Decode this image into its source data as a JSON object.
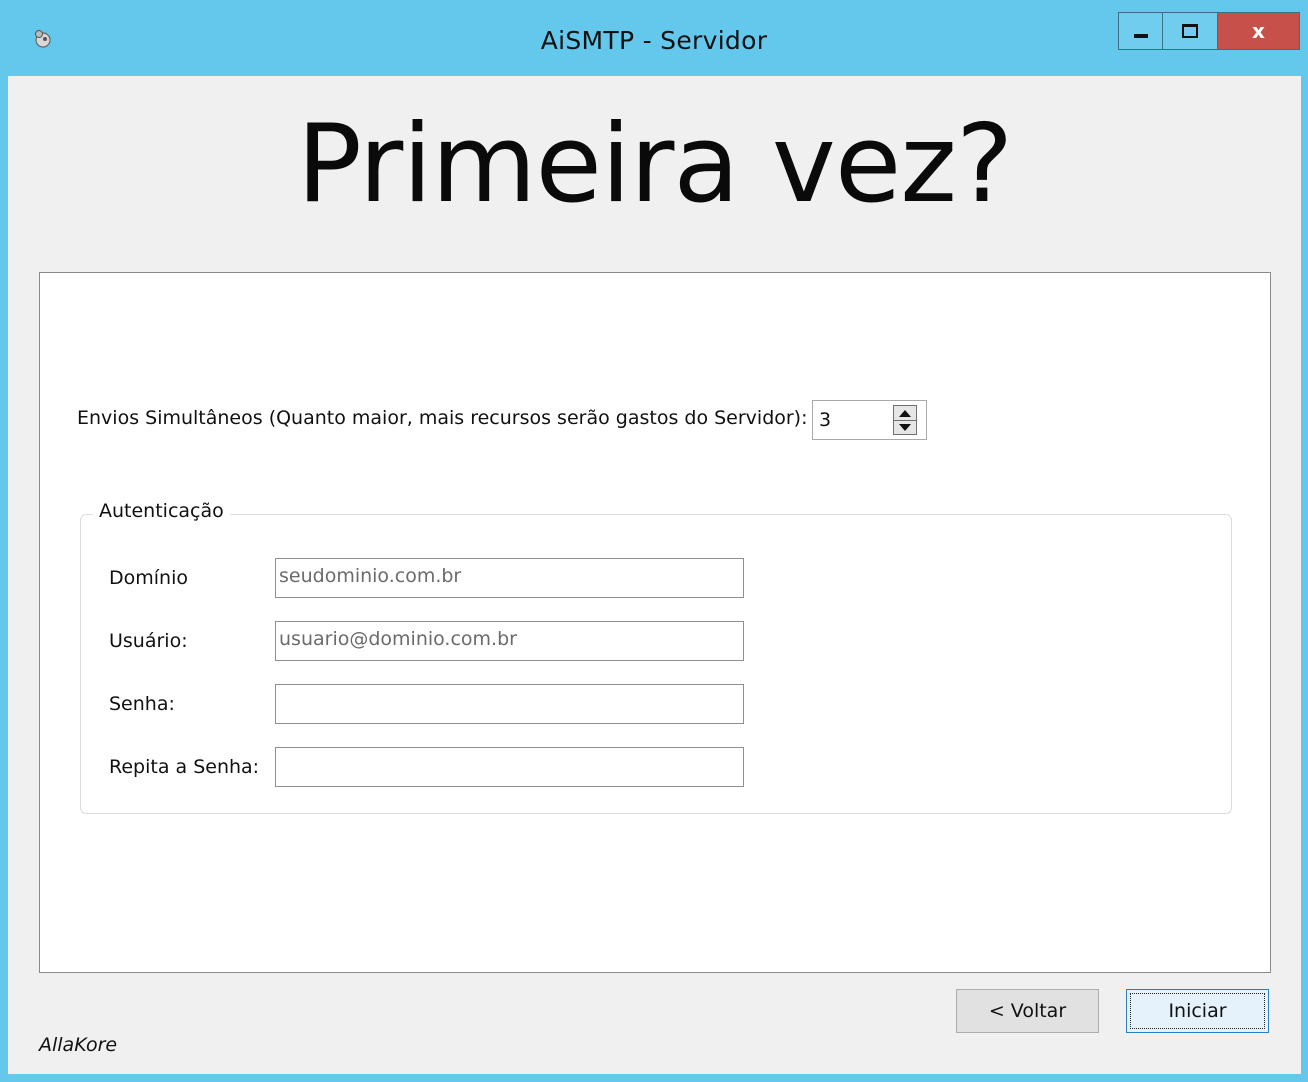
{
  "window": {
    "title": "AiSMTP - Servidor",
    "icon": "app-icon",
    "controls": {
      "minimize": "minimize-icon",
      "maximize": "maximize-icon",
      "close": "x"
    }
  },
  "heading": "Primeira vez?",
  "envios": {
    "label": "Envios Simultâneos (Quanto maior, mais recursos serão gastos do Servidor):",
    "value": "3"
  },
  "auth": {
    "title": "Autenticação",
    "fields": [
      {
        "label": "Domínio",
        "value": "seudominio.com.br"
      },
      {
        "label": "Usuário:",
        "value": "usuario@dominio.com.br"
      },
      {
        "label": "Senha:",
        "value": ""
      },
      {
        "label": "Repita a Senha:",
        "value": ""
      }
    ]
  },
  "buttons": {
    "back": "< Voltar",
    "start": "Iniciar"
  },
  "footer": {
    "brand": "AllaKore"
  },
  "colors": {
    "titlebar": "#64c8ec",
    "close_button": "#c7504a",
    "client": "#f0f0f0"
  }
}
